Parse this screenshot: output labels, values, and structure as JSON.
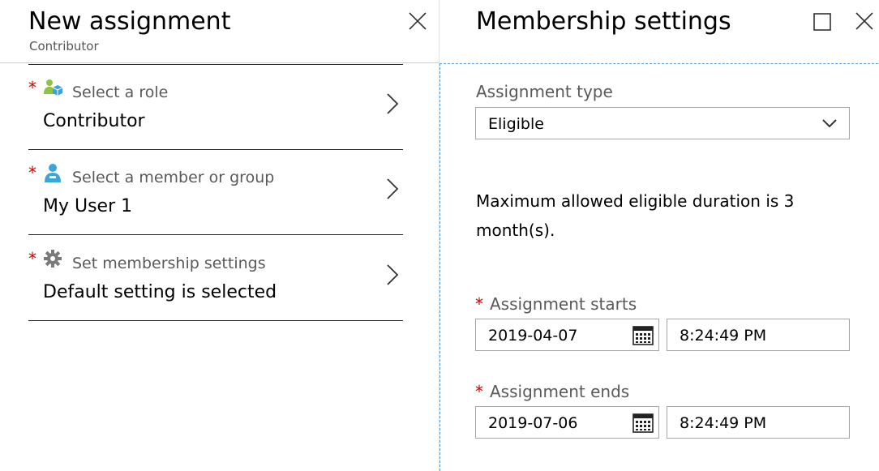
{
  "left_blade": {
    "title": "New assignment",
    "subtitle": "Contributor",
    "close_icon": "close-icon",
    "steps": [
      {
        "label": "Select a role",
        "value": "Contributor",
        "icon": "role-icon",
        "required": "*"
      },
      {
        "label": "Select a member or group",
        "value": "My User 1",
        "icon": "user-icon",
        "required": "*"
      },
      {
        "label": "Set membership settings",
        "value": "Default setting is selected",
        "icon": "gear-icon",
        "required": "*"
      }
    ]
  },
  "right_blade": {
    "title": "Membership settings",
    "maximize_icon": "maximize-icon",
    "close_icon": "close-icon",
    "assignment_type": {
      "label": "Assignment type",
      "value": "Eligible"
    },
    "info": "Maximum allowed eligible duration is 3 month(s).",
    "start": {
      "label": "Assignment starts",
      "date": "2019-04-07",
      "time": "8:24:49 PM",
      "required": "*"
    },
    "end": {
      "label": "Assignment ends",
      "date": "2019-07-06",
      "time": "8:24:49 PM",
      "required": "*"
    }
  },
  "colors": {
    "required": "#d00000",
    "focus_border": "#5aa0d8",
    "role_icon_green": "#8cc63f",
    "user_icon_blue": "#3ba4d8",
    "gear_gray": "#7a7a7a"
  }
}
